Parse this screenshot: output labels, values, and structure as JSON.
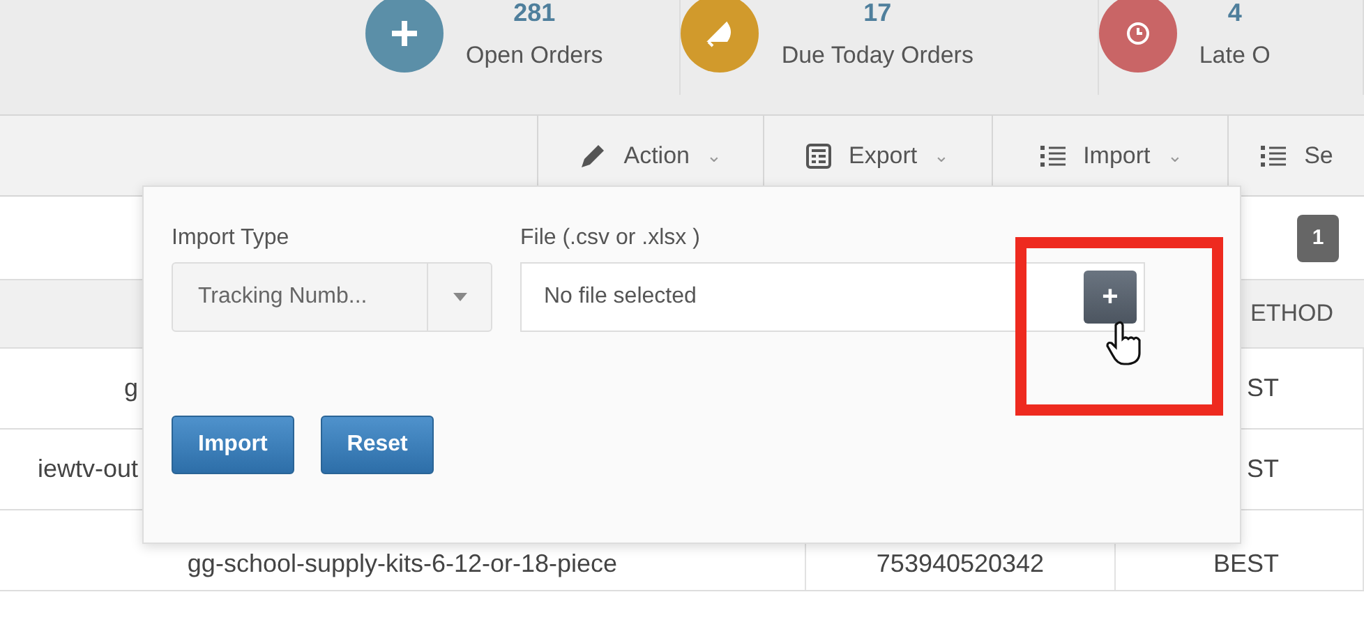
{
  "stats": [
    {
      "count": "281",
      "label": "Open Orders",
      "color": "#5b8fa8"
    },
    {
      "count": "17",
      "label": "Due Today Orders",
      "color": "#d19a2c"
    },
    {
      "count": "4",
      "label": "Late O",
      "color": "#c96566"
    }
  ],
  "toolbar": [
    {
      "label": "Action",
      "caret": "⌄"
    },
    {
      "label": "Export",
      "caret": "⌄"
    },
    {
      "label": "Import",
      "caret": "⌄"
    },
    {
      "label": "Se"
    }
  ],
  "pagination": [
    {
      "label": "1",
      "selected": true
    }
  ],
  "table": {
    "columns": [
      "",
      "",
      "ETHOD"
    ],
    "rows": [
      [
        "g",
        "",
        "ST"
      ],
      [
        "iewtv-out",
        "",
        "ST"
      ],
      [
        "gg-school-supply-kits-6-12-or-18-piece",
        "753940520342",
        "BEST"
      ]
    ]
  },
  "import_popup": {
    "type_label": "Import Type",
    "type_value": "Tracking Numb...",
    "file_label": "File (.csv or .xlsx )",
    "file_placeholder": "No file selected",
    "add_button": "+",
    "buttons": [
      "Import",
      "Reset"
    ],
    "highlighted": true
  }
}
